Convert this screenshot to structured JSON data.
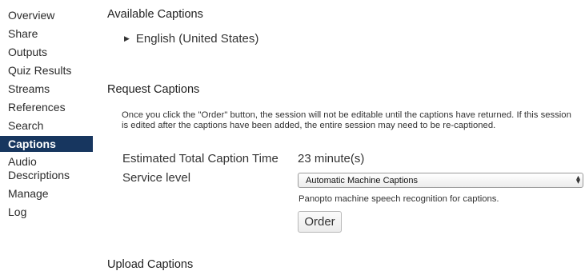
{
  "sidebar": {
    "items": [
      {
        "label": "Overview"
      },
      {
        "label": "Share"
      },
      {
        "label": "Outputs"
      },
      {
        "label": "Quiz Results"
      },
      {
        "label": "Streams"
      },
      {
        "label": "References"
      },
      {
        "label": "Search"
      },
      {
        "label": "Captions",
        "active": true
      },
      {
        "label": "Audio Descriptions"
      },
      {
        "label": "Manage"
      },
      {
        "label": "Log"
      }
    ]
  },
  "available": {
    "title": "Available Captions",
    "items": [
      {
        "label": "English (United States)"
      }
    ]
  },
  "request": {
    "title": "Request Captions",
    "notice": "Once you click the \"Order\" button, the session will not be editable until the captions have returned. If this session is edited after the captions have been added, the entire session may need to be re-captioned.",
    "estimated_label": "Estimated Total Caption Time",
    "estimated_value": "23 minute(s)",
    "service_label": "Service level",
    "service_selected": "Automatic Machine Captions",
    "service_help": "Panopto machine speech recognition for captions.",
    "order_label": "Order"
  },
  "next_section_title": "Upload Captions"
}
